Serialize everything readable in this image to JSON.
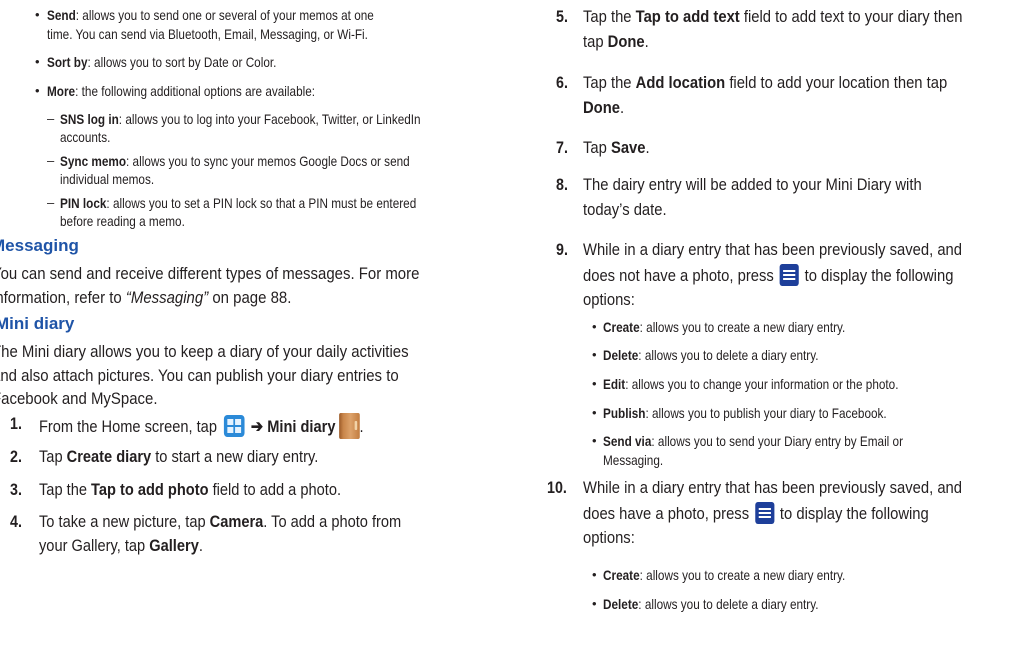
{
  "left_column": {
    "memo_options": [
      {
        "term": "Send",
        "text": ": allows you to send one or several of your memos at one",
        "cont": "time. You can send via Bluetooth, Email, Messaging, or Wi-Fi."
      },
      {
        "term": "Sort by",
        "text": ": allows you to sort by Date or Color."
      },
      {
        "term": "More",
        "text": ": the following additional options are available:"
      }
    ],
    "more_options": [
      {
        "term": "SNS log in",
        "text": ": allows you to log into your Facebook, Twitter, or LinkedIn",
        "cont": "accounts."
      },
      {
        "term": "Sync memo",
        "text": ": allows you to sync your memos Google Docs or send",
        "cont": "individual memos."
      },
      {
        "term": "PIN lock",
        "text": ": allows you to set a PIN lock so that a PIN must be entered",
        "cont": "before reading a memo."
      }
    ],
    "messaging": {
      "heading": "Messaging",
      "line1": "You can send and receive different types of messages. For more",
      "line2_pre": "information, refer to ",
      "line2_ref": "“Messaging”",
      "line2_post": "  on page 88."
    },
    "mini_diary": {
      "heading": "Mini diary",
      "lines": [
        "The Mini diary allows you to keep a diary of your daily activities",
        "and also attach pictures. You can publish your diary entries to",
        "Facebook and MySpace."
      ]
    },
    "steps": {
      "s1": {
        "num": "1.",
        "pre": "From the Home screen, tap ",
        "arrow": "➔",
        "bold": "Mini diary"
      },
      "s2": {
        "num": "2.",
        "pre": "Tap ",
        "bold": "Create diary",
        "post": " to start a new diary entry."
      },
      "s3": {
        "num": "3.",
        "pre": "Tap the ",
        "bold": "Tap to add photo",
        "post": " field to add a photo."
      },
      "s4": {
        "num": "4.",
        "pre": "To take a new picture, tap ",
        "bold": "Camera",
        "post": ". To add a photo from",
        "l2_pre": "your Gallery, tap ",
        "l2_bold": "Gallery",
        "l2_post": "."
      }
    }
  },
  "right_column": {
    "s5": {
      "num": "5.",
      "pre": "Tap the ",
      "bold": "Tap to add text",
      "post": " field to add text to your diary then",
      "l2_pre": "tap ",
      "l2_bold": "Done",
      "l2_post": "."
    },
    "s6": {
      "num": "6.",
      "pre": "Tap the ",
      "bold": "Add location",
      "post": " field to add your location then tap",
      "l2_bold": "Done",
      "l2_post": "."
    },
    "s7": {
      "num": "7.",
      "pre": "Tap ",
      "bold": "Save",
      "post": "."
    },
    "s8": {
      "num": "8.",
      "line1": "The dairy entry will be added to your Mini Diary with",
      "line2": "today’s date."
    },
    "s9": {
      "num": "9.",
      "line1": "While in a diary entry that has been previously saved, and",
      "line2_pre": "does not have a photo, press ",
      "line2_post": " to display the following",
      "line3": "options:"
    },
    "s9_options": [
      {
        "term": "Create",
        "text": ": allows you to create a new diary entry."
      },
      {
        "term": "Delete",
        "text": ": allows you to delete a diary entry."
      },
      {
        "term": "Edit",
        "text": ": allows you to change your information or the photo."
      },
      {
        "term": "Publish",
        "text": ": allows you to publish your diary to Facebook."
      },
      {
        "term": "Send via",
        "text": ": allows you to send your Diary entry by Email or",
        "cont": "Messaging."
      }
    ],
    "s10": {
      "num": "10.",
      "line1": "While in a diary entry that has been previously saved, and",
      "line2_pre": "does have a photo, press ",
      "line2_post": " to display the following",
      "line3": "options:"
    },
    "s10_options": [
      {
        "term": "Create",
        "text": ": allows you to create a new diary entry."
      },
      {
        "term": "Delete",
        "text": ": allows you to delete a diary entry."
      }
    ]
  }
}
